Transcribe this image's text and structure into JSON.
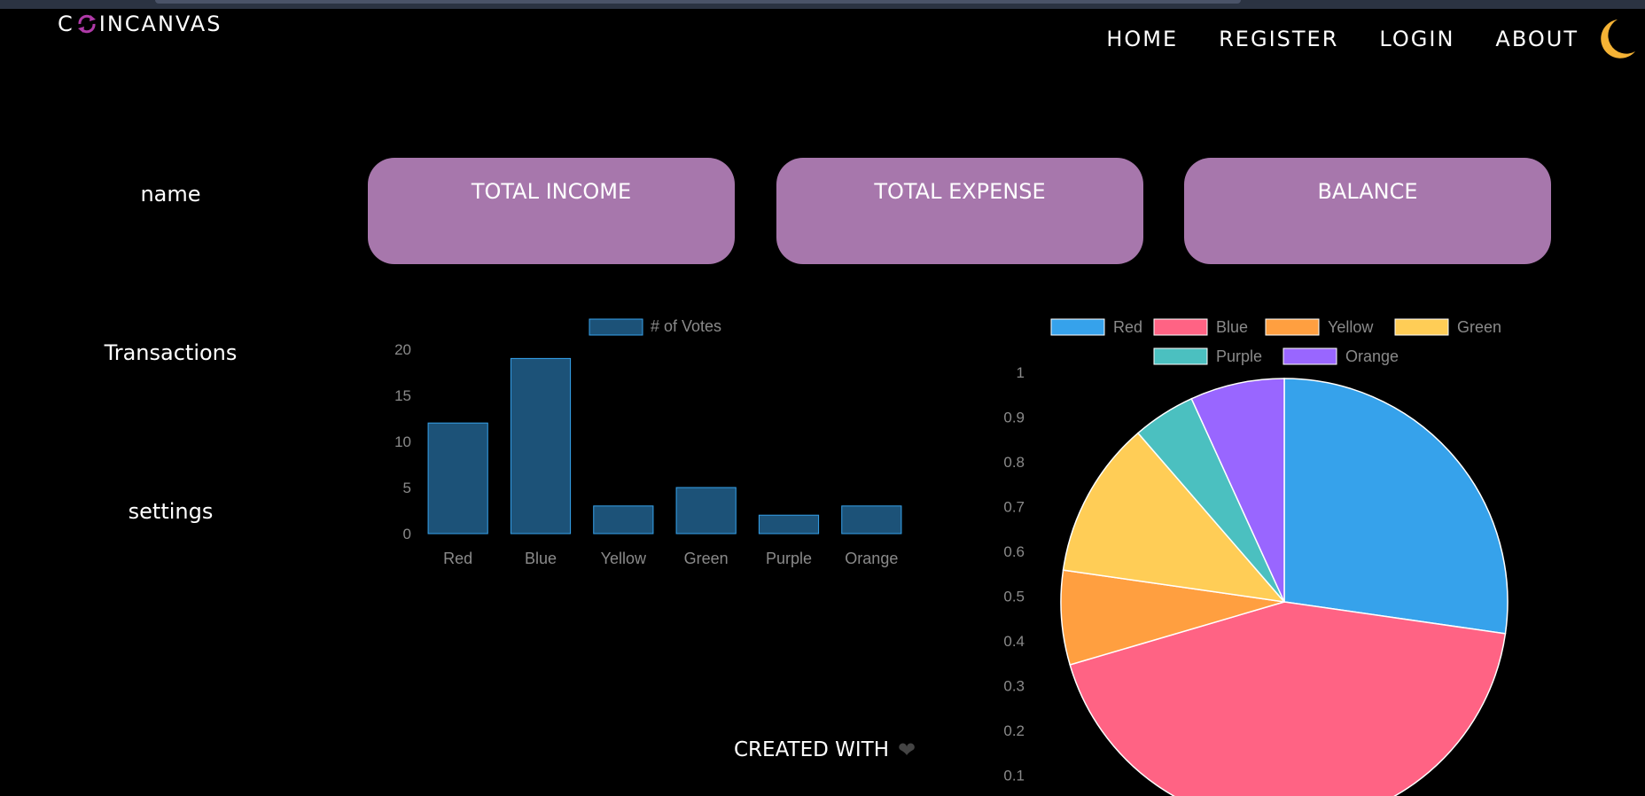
{
  "header": {
    "logo_prefix": "C",
    "logo_suffix": "INCANVAS",
    "nav": [
      "HOME",
      "REGISTER",
      "LOGIN",
      "ABOUT"
    ]
  },
  "sidebar": {
    "items": [
      "name",
      "Transactions",
      "settings"
    ]
  },
  "cards": [
    {
      "title": "TOTAL INCOME"
    },
    {
      "title": "TOTAL EXPENSE"
    },
    {
      "title": "BALANCE"
    }
  ],
  "footer": {
    "text": "CREATED WITH"
  },
  "colors": {
    "card": "#a777ac",
    "bar_fill": "#1c5278",
    "bar_border": "#36a2eb",
    "logo_accent": "#b03aa8",
    "moon": "#f5b335"
  },
  "chart_data": [
    {
      "type": "bar",
      "categories": [
        "Red",
        "Blue",
        "Yellow",
        "Green",
        "Purple",
        "Orange"
      ],
      "series": [
        {
          "name": "# of Votes",
          "values": [
            12,
            19,
            3,
            5,
            2,
            3
          ]
        }
      ],
      "yticks": [
        "0",
        "5",
        "10",
        "15",
        "20"
      ],
      "ylim": [
        0,
        20
      ],
      "legend": "top"
    },
    {
      "type": "pie",
      "categories": [
        "Red",
        "Blue",
        "Yellow",
        "Green",
        "Purple",
        "Orange"
      ],
      "values": [
        12,
        19,
        3,
        5,
        2,
        3
      ],
      "colors": [
        "#36a2eb",
        "#ff6384",
        "#ff9f40",
        "#ffcd56",
        "#4bc0c0",
        "#9966ff"
      ],
      "yticks": [
        "0.1",
        "0.2",
        "0.3",
        "0.4",
        "0.5",
        "0.6",
        "0.7",
        "0.8",
        "0.9",
        "1"
      ],
      "legend": "top"
    }
  ]
}
